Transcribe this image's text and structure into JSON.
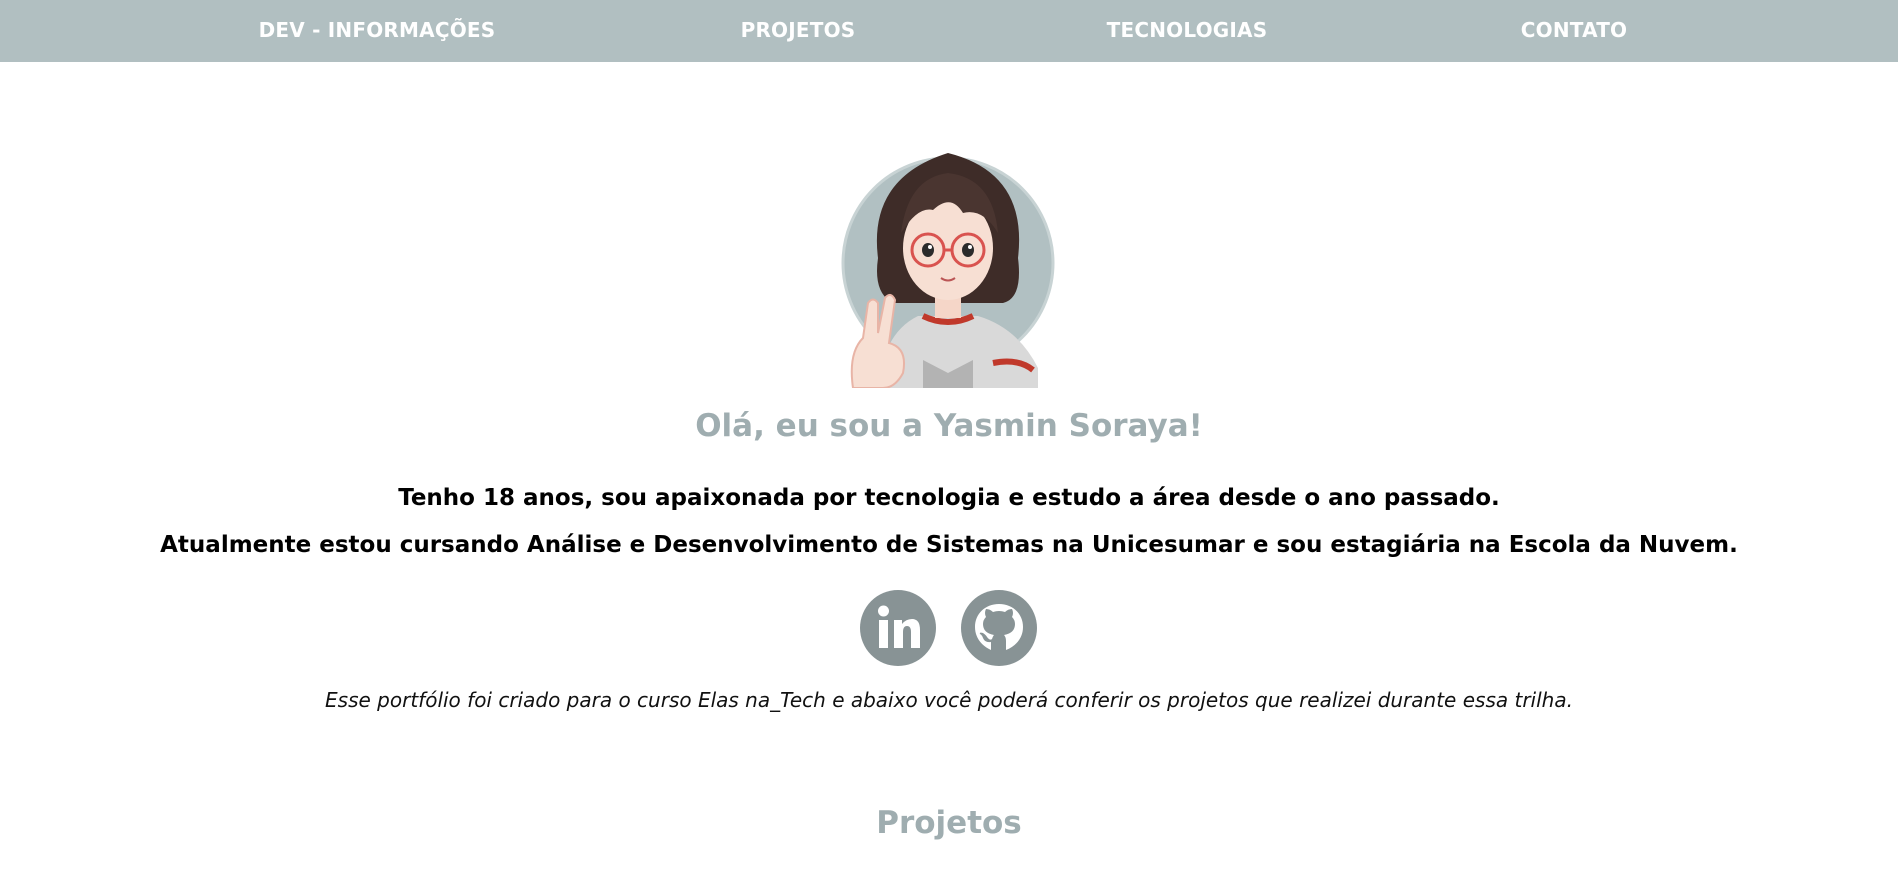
{
  "nav": {
    "items": [
      {
        "label": "DEV - INFORMAÇÕES"
      },
      {
        "label": "PROJETOS"
      },
      {
        "label": "TECNOLOGIAS"
      },
      {
        "label": "CONTATO"
      }
    ]
  },
  "hero": {
    "avatar_icon": "anime-girl-avatar-peace-sign",
    "greeting": "Olá, eu sou a Yasmin Soraya!",
    "intro_line1": "Tenho 18 anos, sou apaixonada por tecnologia e estudo a área desde o ano passado.",
    "intro_line2": "Atualmente estou cursando Análise e Desenvolvimento de Sistemas na Unicesumar e sou estagiária na Escola da Nuvem.",
    "social": [
      {
        "icon": "linkedin-icon"
      },
      {
        "icon": "github-icon"
      }
    ],
    "note": "Esse portfólio foi criado para o curso Elas na_Tech e abaixo você poderá conferir os projetos que realizei durante essa trilha."
  },
  "projects": {
    "title": "Projetos"
  },
  "colors": {
    "nav_bg": "#b1bfc1",
    "accent_text": "#9fadb0",
    "social_bg": "#889395"
  }
}
